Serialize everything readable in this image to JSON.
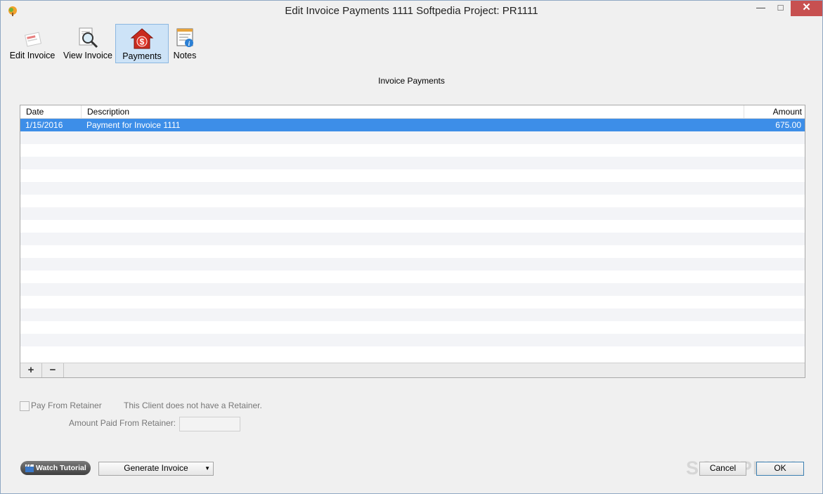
{
  "window": {
    "title": "Edit Invoice Payments 1111 Softpedia Project: PR1111",
    "controls": {
      "minimize": "—",
      "maximize": "□",
      "close": "✕"
    }
  },
  "toolbar": {
    "items": [
      {
        "label": "Edit Invoice",
        "icon": "edit-invoice-icon",
        "active": false
      },
      {
        "label": "View Invoice",
        "icon": "magnifier-icon",
        "active": false
      },
      {
        "label": "Payments",
        "icon": "dollar-house-icon",
        "active": true
      },
      {
        "label": "Notes",
        "icon": "notes-icon",
        "active": false
      }
    ]
  },
  "section_title": "Invoice Payments",
  "payments_table": {
    "columns": [
      "Date",
      "Description",
      "Amount"
    ],
    "rows": [
      {
        "date": "1/15/2016",
        "description": "Payment for Invoice 1111",
        "amount": "675.00",
        "selected": true
      }
    ],
    "footer": {
      "add": "+",
      "remove": "−"
    }
  },
  "retainer": {
    "checkbox_label": "Pay From Retainer",
    "checked": false,
    "status_text": "This Client does not have a Retainer.",
    "amount_label": "Amount Paid From Retainer:",
    "amount_value": ""
  },
  "footer": {
    "tutorial_label": "Watch Tutorial",
    "generate_label": "Generate Invoice",
    "cancel_label": "Cancel",
    "ok_label": "OK",
    "watermark": "SOFTPEDIA"
  },
  "colors": {
    "selection": "#3d8ee8",
    "active_tool": "#cde3f7",
    "close_button": "#c75050"
  }
}
